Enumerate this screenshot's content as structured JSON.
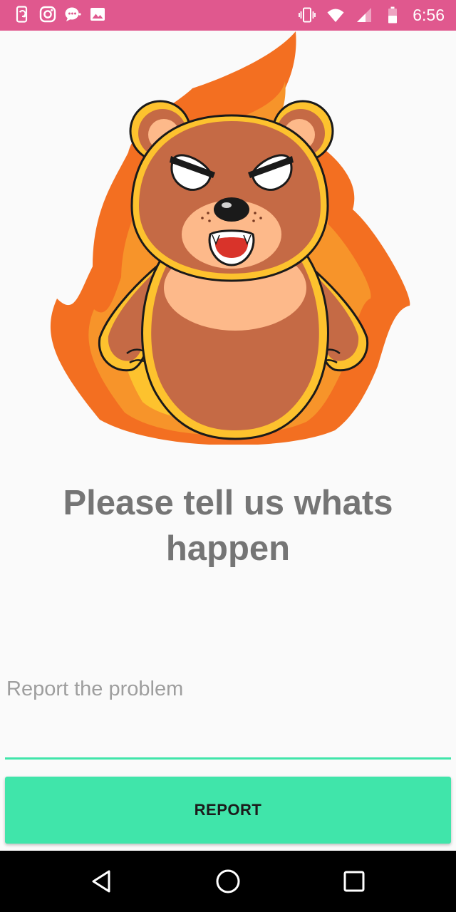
{
  "status_bar": {
    "time": "6:56",
    "left_icons": [
      "phone-sync-icon",
      "instagram-icon",
      "chat-bubble-icon",
      "image-icon"
    ],
    "right_icons": [
      "vibrate-icon",
      "wifi-icon",
      "signal-icon",
      "battery-icon"
    ],
    "background_color": "#e0588e"
  },
  "hero": {
    "illustration": "angry-bear-on-fire"
  },
  "main": {
    "title": "Please tell us whats happen",
    "report_input": {
      "placeholder": "Report the problem",
      "value": ""
    },
    "report_button_label": "REPORT",
    "accent_color": "#40e5aa"
  },
  "nav_bar": {
    "buttons": [
      "back-icon",
      "home-icon",
      "recents-icon"
    ]
  }
}
